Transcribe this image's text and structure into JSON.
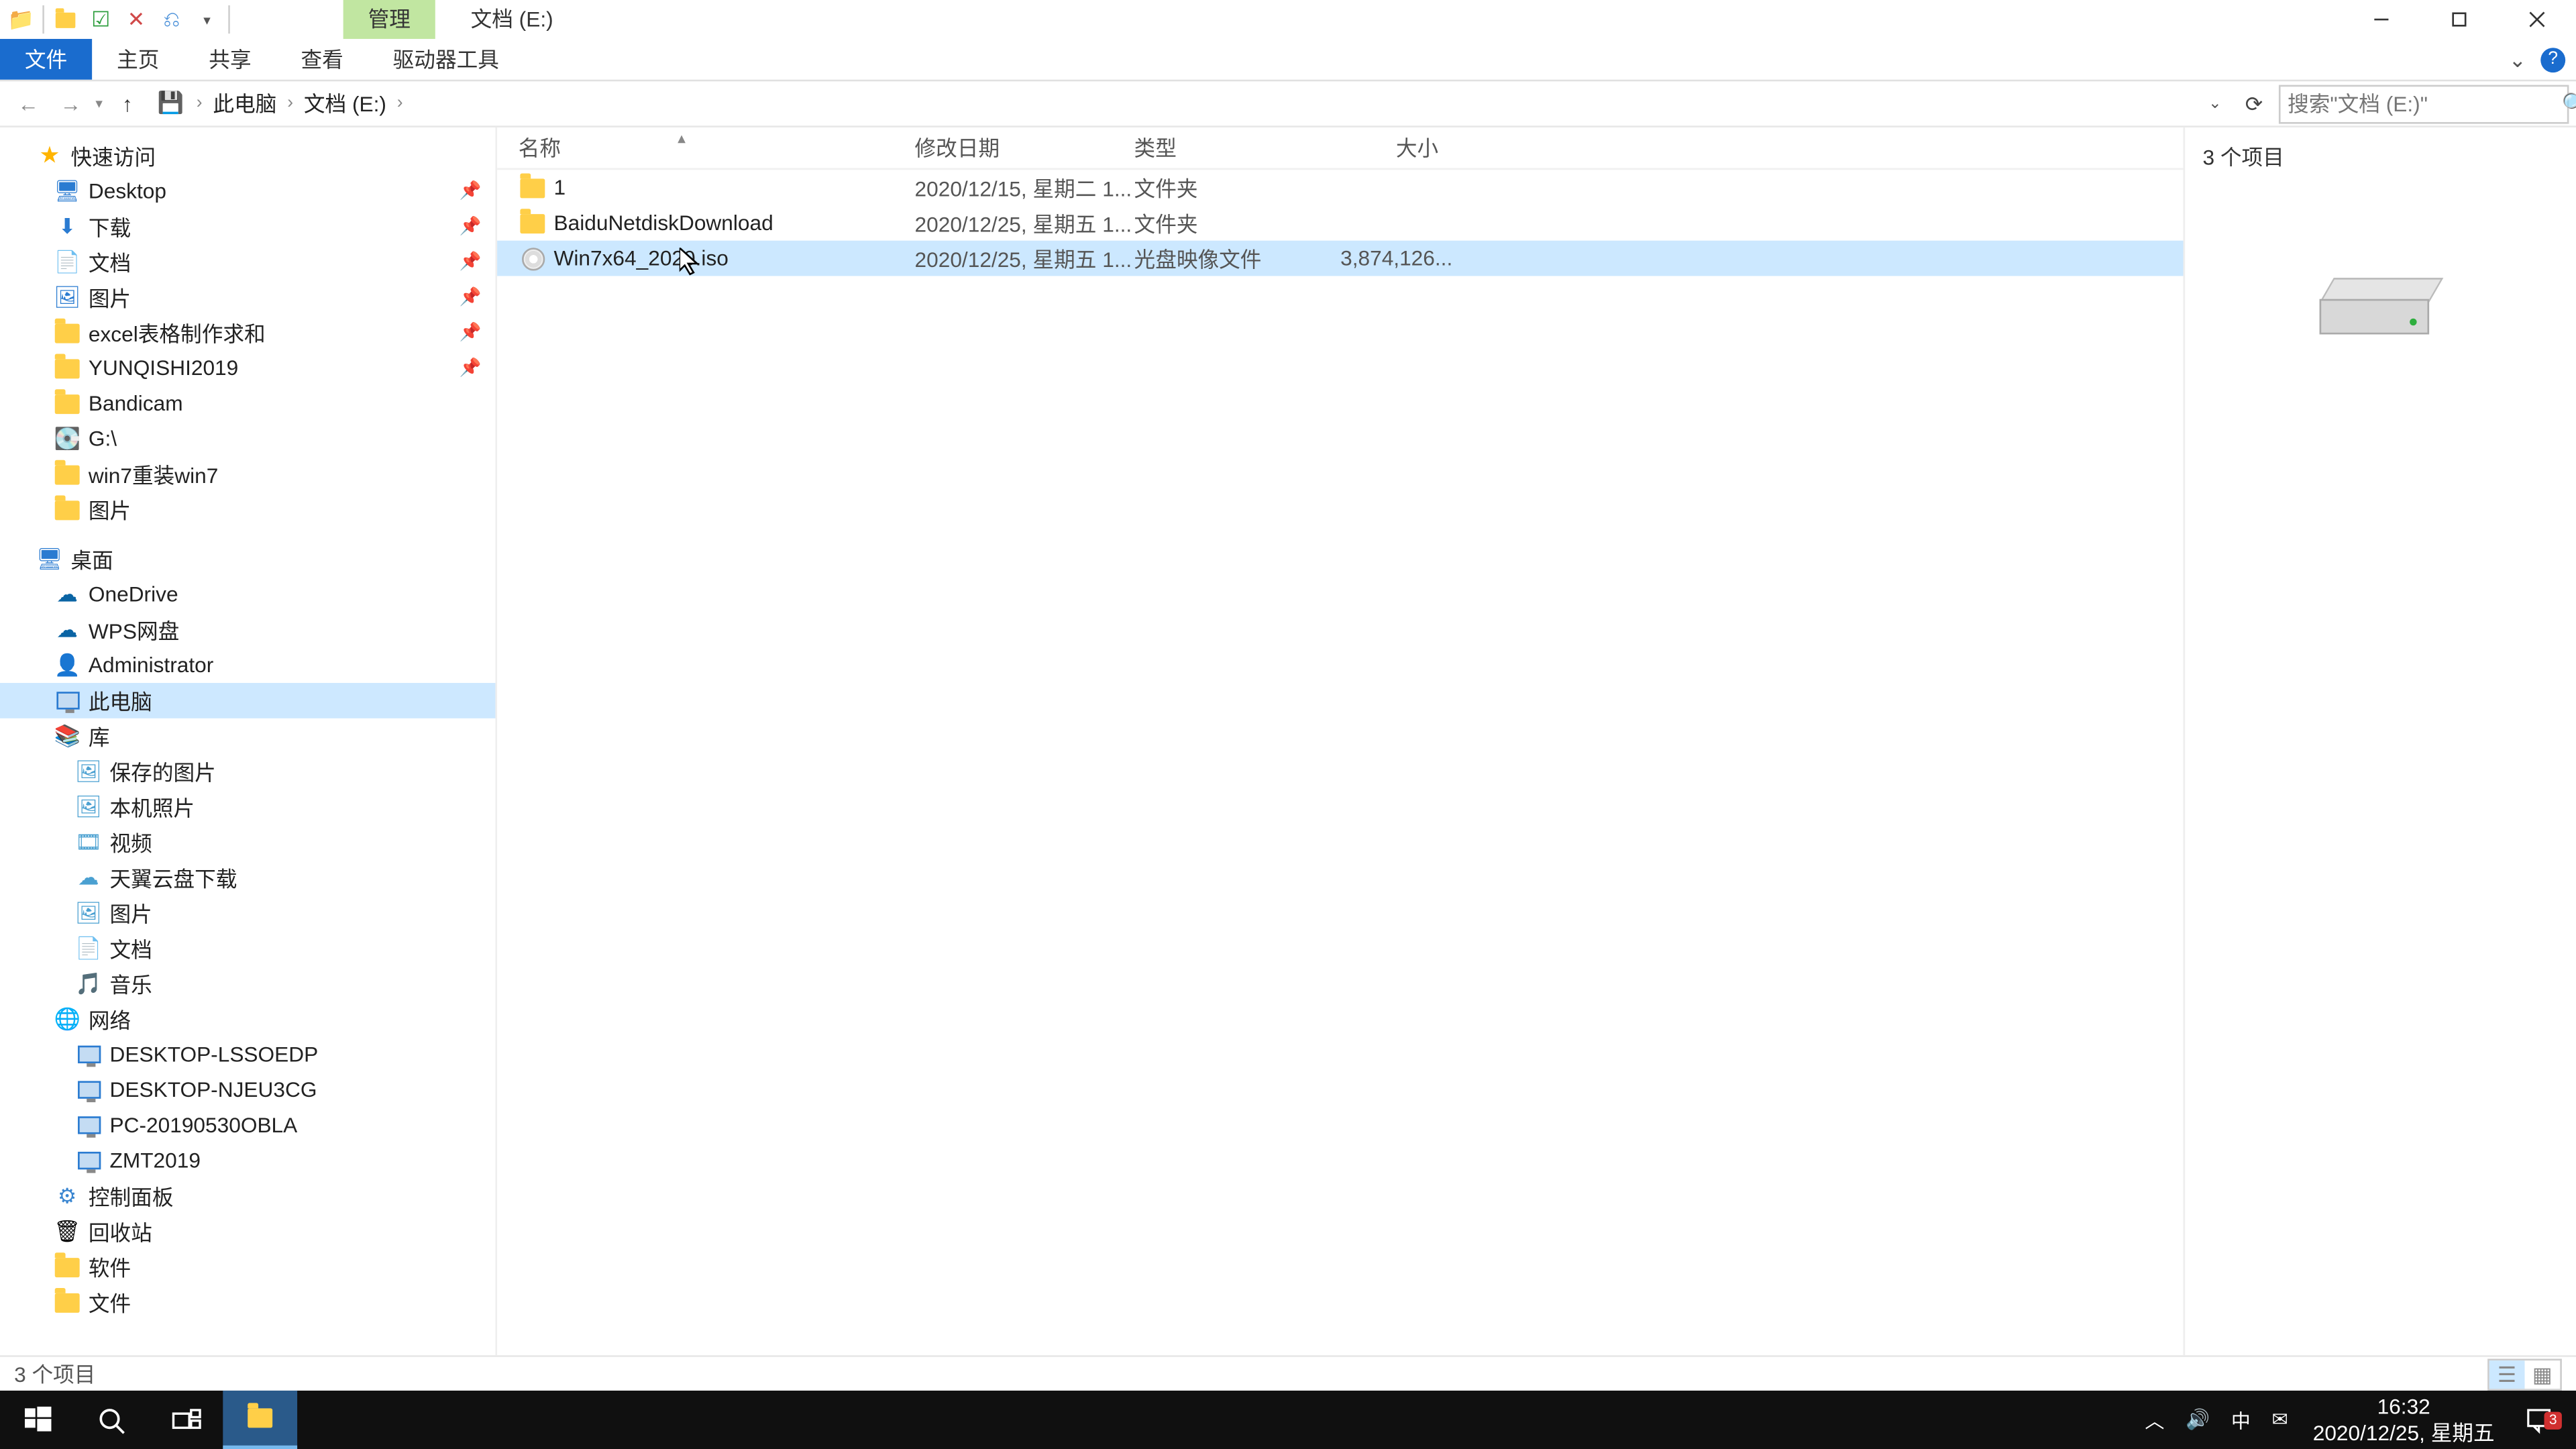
{
  "titlebar": {
    "context_tab": "管理",
    "location_title": "文档 (E:)"
  },
  "ribbon": {
    "file": "文件",
    "home": "主页",
    "share": "共享",
    "view": "查看",
    "drive_tools": "驱动器工具"
  },
  "breadcrumb": {
    "seg1": "此电脑",
    "seg2": "文档 (E:)"
  },
  "search": {
    "placeholder": "搜索\"文档 (E:)\""
  },
  "nav": {
    "quick_access": "快速访问",
    "desktop": "Desktop",
    "downloads": "下载",
    "documents": "文档",
    "pictures": "图片",
    "excel": "excel表格制作求和",
    "yunqishi": "YUNQISHI2019",
    "bandicam": "Bandicam",
    "gdrive": "G:\\",
    "win7reinstall": "win7重装win7",
    "pictures2": "图片",
    "desktop_zh": "桌面",
    "onedrive": "OneDrive",
    "wps": "WPS网盘",
    "administrator": "Administrator",
    "this_pc": "此电脑",
    "libraries": "库",
    "saved_pictures": "保存的图片",
    "camera_roll": "本机照片",
    "videos": "视频",
    "tianyi": "天翼云盘下载",
    "lib_pictures": "图片",
    "lib_documents": "文档",
    "lib_music": "音乐",
    "network": "网络",
    "pc1": "DESKTOP-LSSOEDP",
    "pc2": "DESKTOP-NJEU3CG",
    "pc3": "PC-20190530OBLA",
    "pc4": "ZMT2019",
    "control_panel": "控制面板",
    "recycle_bin": "回收站",
    "software": "软件",
    "files": "文件"
  },
  "columns": {
    "name": "名称",
    "date": "修改日期",
    "type": "类型",
    "size": "大小"
  },
  "files": [
    {
      "name": "1",
      "date": "2020/12/15, 星期二 1...",
      "type": "文件夹",
      "size": ""
    },
    {
      "name": "BaiduNetdiskDownload",
      "date": "2020/12/25, 星期五 1...",
      "type": "文件夹",
      "size": ""
    },
    {
      "name": "Win7x64_2020.iso",
      "date": "2020/12/25, 星期五 1...",
      "type": "光盘映像文件",
      "size": "3,874,126..."
    }
  ],
  "preview": {
    "title": "3 个项目"
  },
  "status": {
    "text": "3 个项目"
  },
  "taskbar": {
    "ime": "中",
    "time": "16:32",
    "date": "2020/12/25, 星期五",
    "notif_count": "3"
  }
}
